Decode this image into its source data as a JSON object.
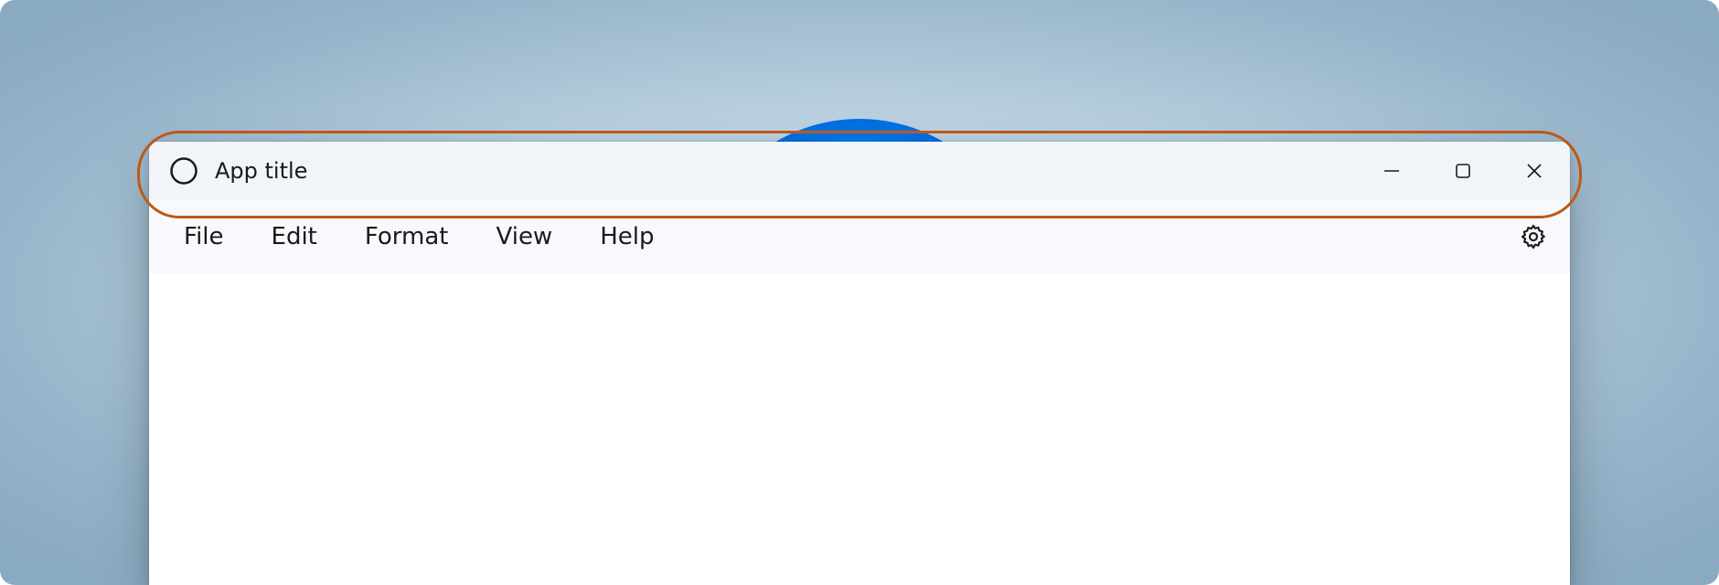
{
  "titlebar": {
    "title": "App title",
    "icons": {
      "app": "circle-icon",
      "minimize": "minimize-icon",
      "maximize": "maximize-icon",
      "close": "close-icon"
    }
  },
  "menubar": {
    "items": [
      {
        "label": "File"
      },
      {
        "label": "Edit"
      },
      {
        "label": "Format"
      },
      {
        "label": "View"
      },
      {
        "label": "Help"
      }
    ],
    "settings_icon": "gear-icon"
  },
  "colors": {
    "highlight": "#bc5a17",
    "window_bg": "#ffffff",
    "titlebar_bg": "#f1f4f9",
    "menubar_bg": "#f7f9fc"
  }
}
